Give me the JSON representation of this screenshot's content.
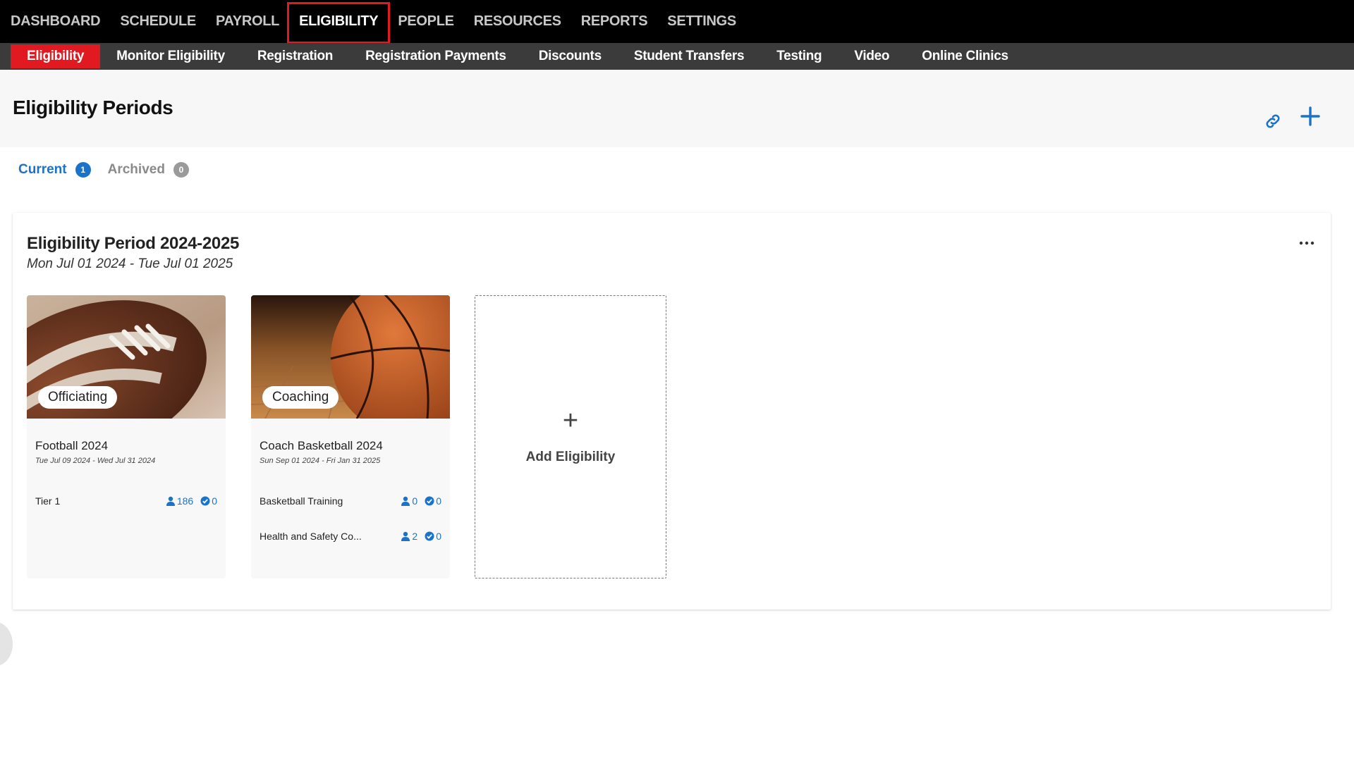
{
  "topnav": {
    "items": [
      {
        "label": "DASHBOARD"
      },
      {
        "label": "SCHEDULE"
      },
      {
        "label": "PAYROLL"
      },
      {
        "label": "ELIGIBILITY"
      },
      {
        "label": "PEOPLE"
      },
      {
        "label": "RESOURCES"
      },
      {
        "label": "REPORTS"
      },
      {
        "label": "SETTINGS"
      }
    ],
    "active": "ELIGIBILITY"
  },
  "subnav": {
    "items": [
      {
        "label": "Eligibility"
      },
      {
        "label": "Monitor Eligibility"
      },
      {
        "label": "Registration"
      },
      {
        "label": "Registration Payments"
      },
      {
        "label": "Discounts"
      },
      {
        "label": "Student Transfers"
      },
      {
        "label": "Testing"
      },
      {
        "label": "Video"
      },
      {
        "label": "Online Clinics"
      }
    ],
    "active": "Eligibility"
  },
  "header": {
    "title": "Eligibility Periods",
    "icons": [
      "link-icon",
      "plus-icon"
    ]
  },
  "tabs": {
    "current": {
      "label": "Current",
      "count": "1"
    },
    "archived": {
      "label": "Archived",
      "count": "0"
    }
  },
  "period": {
    "title": "Eligibility Period 2024-2025",
    "dates": "Mon Jul 01 2024 - Tue Jul 01 2025",
    "cards": [
      {
        "tag": "Officiating",
        "name": "Football 2024",
        "dates": "Tue Jul 09 2024 - Wed Jul 31 2024",
        "requirements": [
          {
            "label": "Tier 1",
            "people": "186",
            "verified": "0"
          }
        ]
      },
      {
        "tag": "Coaching",
        "name": "Coach Basketball 2024",
        "dates": "Sun Sep 01 2024 - Fri Jan 31 2025",
        "requirements": [
          {
            "label": "Basketball Training",
            "people": "0",
            "verified": "0"
          },
          {
            "label": "Health and Safety Co...",
            "people": "2",
            "verified": "0"
          }
        ]
      }
    ],
    "add_card": {
      "plus": "+",
      "label": "Add Eligibility"
    }
  },
  "colors": {
    "accent_red": "#e11a22",
    "link_blue": "#1a73c8",
    "nav_black": "#000000",
    "subnav_gray": "#3b3b3b"
  }
}
